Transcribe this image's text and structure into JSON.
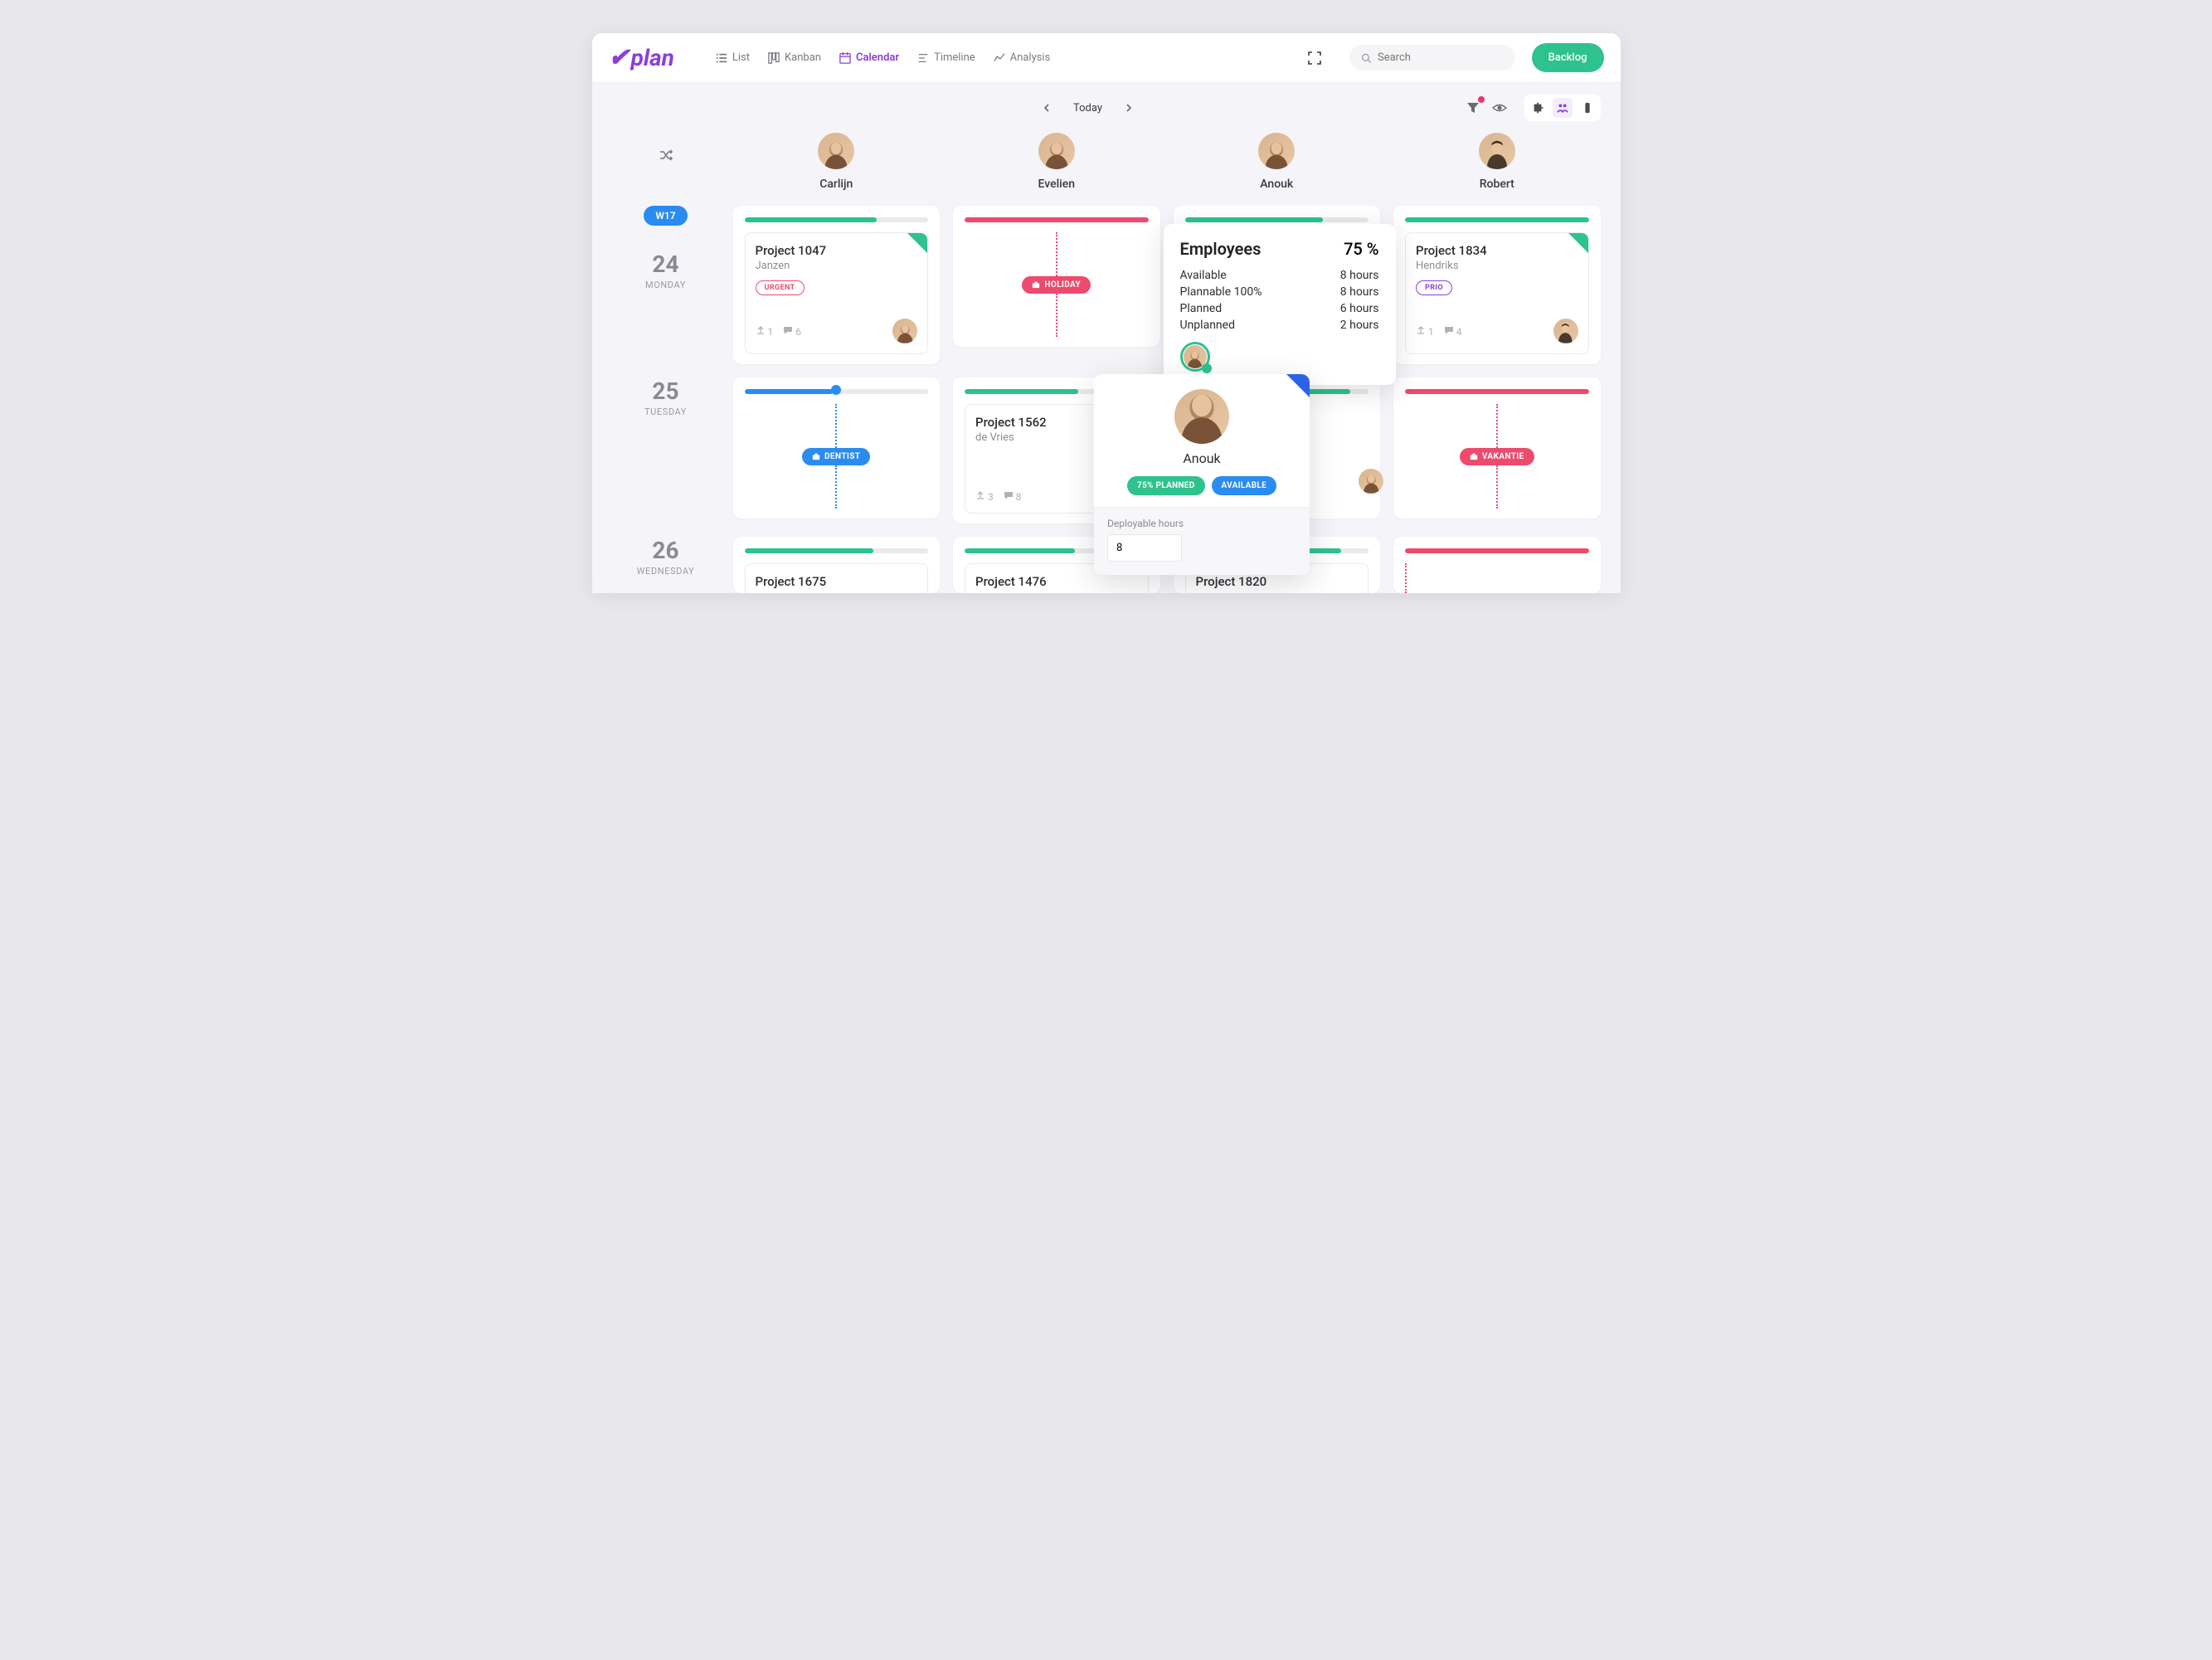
{
  "brand": "plan",
  "nav": {
    "list": "List",
    "kanban": "Kanban",
    "calendar": "Calendar",
    "timeline": "Timeline",
    "analysis": "Analysis"
  },
  "search": {
    "placeholder": "Search"
  },
  "backlog": "Backlog",
  "today": "Today",
  "week": "W17",
  "days": [
    {
      "num": "24",
      "name": "MONDAY"
    },
    {
      "num": "25",
      "name": "TUESDAY"
    },
    {
      "num": "26",
      "name": "WEDNESDAY"
    }
  ],
  "employees": [
    "Carlijn",
    "Evelien",
    "Anouk",
    "Robert"
  ],
  "cards": {
    "p1047": {
      "title": "Project 1047",
      "client": "Janzen",
      "tag": "URGENT",
      "attach": "1",
      "comments": "6"
    },
    "p1834": {
      "title": "Project 1834",
      "client": "Hendriks",
      "tag": "PRIO",
      "attach": "1",
      "comments": "4"
    },
    "p1562": {
      "title": "Project 1562",
      "client": "de Vries",
      "attach": "3",
      "comments": "8"
    },
    "p1675": {
      "title": "Project 1675"
    },
    "p1476": {
      "title": "Project 1476"
    },
    "p1820": {
      "title": "Project 1820"
    }
  },
  "markers": {
    "holiday": "HOLIDAY",
    "dentist": "DENTIST",
    "vakantie": "VAKANTIE"
  },
  "popover": {
    "title": "Employees",
    "percent": "75 %",
    "available_label": "Available",
    "available_val": "8 hours",
    "plannable_label": "Plannable 100%",
    "plannable_val": "8 hours",
    "planned_label": "Planned",
    "planned_val": "6 hours",
    "unplanned_label": "Unplanned",
    "unplanned_val": "2 hours"
  },
  "employee_card": {
    "name": "Anouk",
    "pill1": "75% PLANNED",
    "pill2": "AVAILABLE",
    "deploy_label": "Deployable hours",
    "deploy_value": "8"
  }
}
